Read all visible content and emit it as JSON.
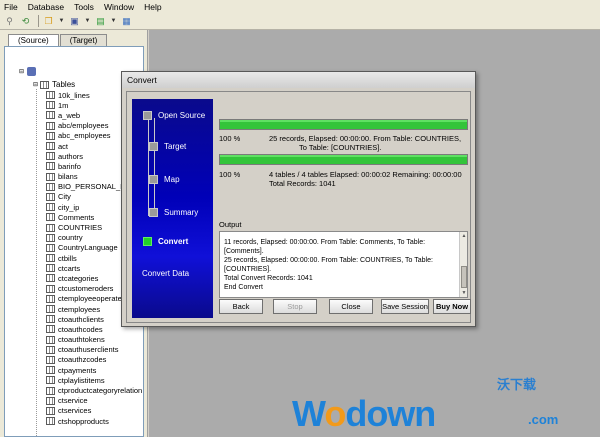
{
  "menu": [
    "File",
    "Database",
    "Tools",
    "Window",
    "Help"
  ],
  "left_panel": {
    "tabs": [
      "(Source)",
      "(Target)"
    ],
    "tables_label": "Tables",
    "tables": [
      "10k_lines",
      "1m",
      "a_web",
      "abc/employees",
      "abc_employees",
      "act",
      "authors",
      "barinfo",
      "bilans",
      "BIO_PERSONAL_INF",
      "City",
      "city_ip",
      "Comments",
      "COUNTRIES",
      "country",
      "CountryLanguage",
      "ctbills",
      "ctcarts",
      "ctcategories",
      "ctcustomeroders",
      "ctemployeeoperatelog",
      "ctemployees",
      "ctoauthclients",
      "ctoauthcodes",
      "ctoauthtokens",
      "ctoauthuserclients",
      "ctoauthzcodes",
      "ctpayments",
      "ctplaylistitems",
      "ctproductcategoryrelation",
      "ctservice",
      "ctservices",
      "ctshopproducts"
    ]
  },
  "dialog": {
    "title": "Convert",
    "steps": [
      "Open Source",
      "Target",
      "Map",
      "Summary",
      "Convert"
    ],
    "convert_data_label": "Convert Data",
    "progress1": {
      "percent": "100 %",
      "line1": "25 records,    Elapsed: 00:00:00.    From Table: COUNTRIES,",
      "line2": "To Table: [COUNTRIES]."
    },
    "progress2": {
      "percent": "100 %",
      "line1": "4 tables / 4 tables    Elapsed: 00:00:02    Remaining: 00:00:00",
      "line2": "Total Records: 1041"
    },
    "output_label": "Output",
    "output_lines": [
      "11 records,    Elapsed: 00:00:00.    From Table: Comments,    To Table:",
      "[Comments].",
      "25 records,    Elapsed: 00:00:00.    From Table: COUNTRIES,    To Table:",
      "[COUNTRIES].",
      "Total Convert Records: 1041",
      "End Convert"
    ],
    "buttons": {
      "back": "Back",
      "stop": "Stop",
      "close": "Close",
      "save_session": "Save Session",
      "buy_now": "Buy Now"
    }
  },
  "watermark": {
    "logo_w": "W",
    "logo_o": "o",
    "logo_rest": "down",
    "dotcom": ".com",
    "cn": "沃下载"
  }
}
